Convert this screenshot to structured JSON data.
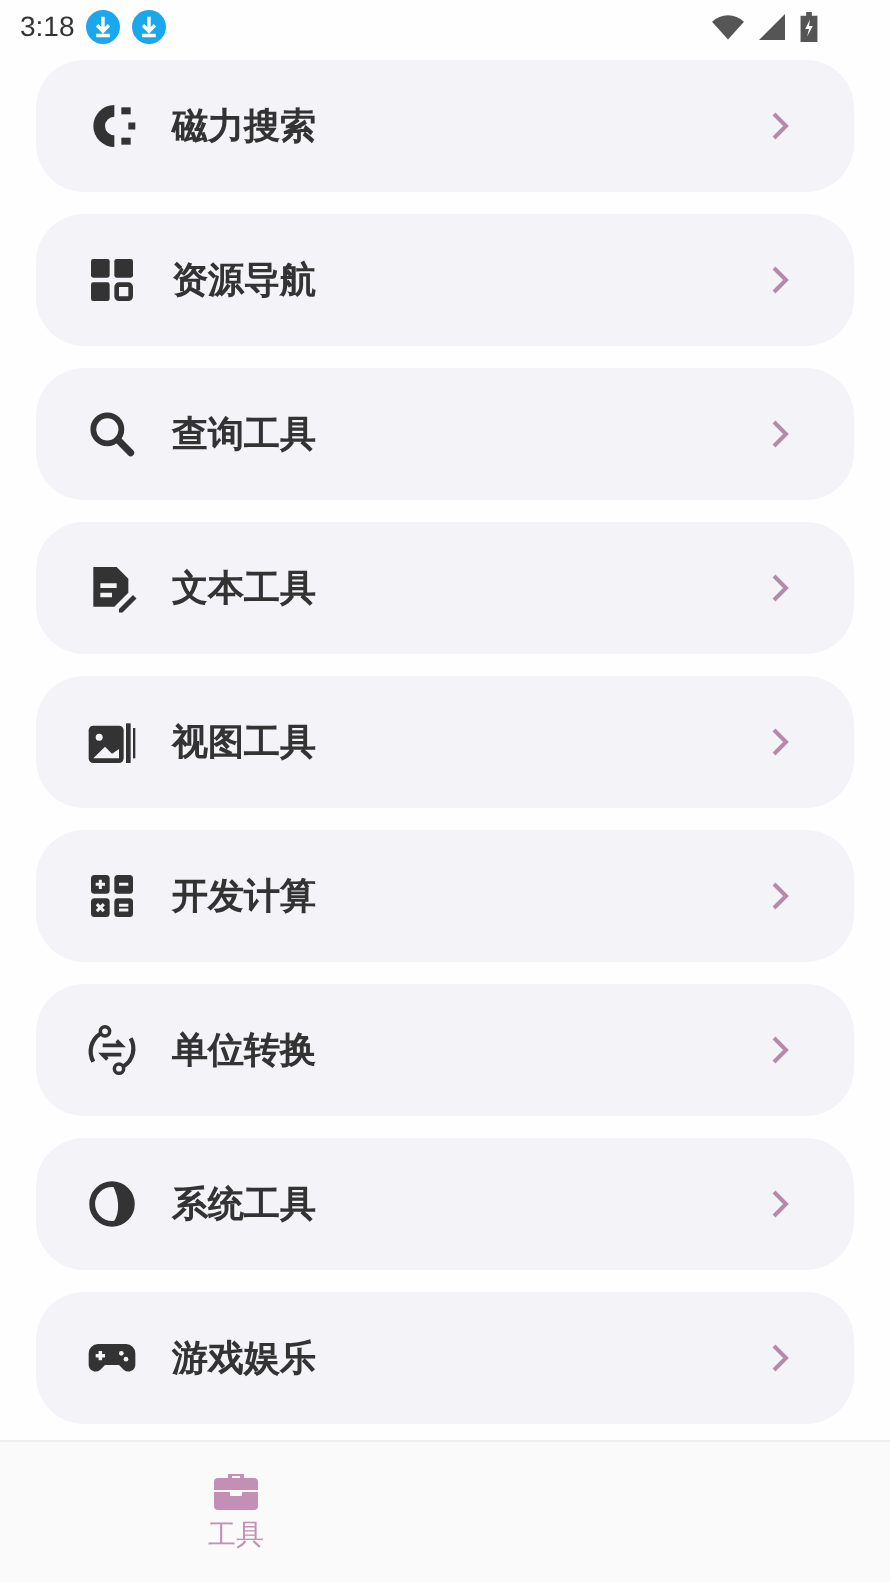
{
  "status_bar": {
    "time": "3:18",
    "notifications": [
      {
        "kind": "download"
      },
      {
        "kind": "download"
      }
    ]
  },
  "menu": [
    {
      "label": "磁力搜索"
    },
    {
      "label": "资源导航"
    },
    {
      "label": "查询工具"
    },
    {
      "label": "文本工具"
    },
    {
      "label": "视图工具"
    },
    {
      "label": "开发计算"
    },
    {
      "label": "单位转换"
    },
    {
      "label": "系统工具"
    },
    {
      "label": "游戏娱乐"
    }
  ],
  "bottom_nav": [
    {
      "label": "工具",
      "selected": true
    }
  ]
}
